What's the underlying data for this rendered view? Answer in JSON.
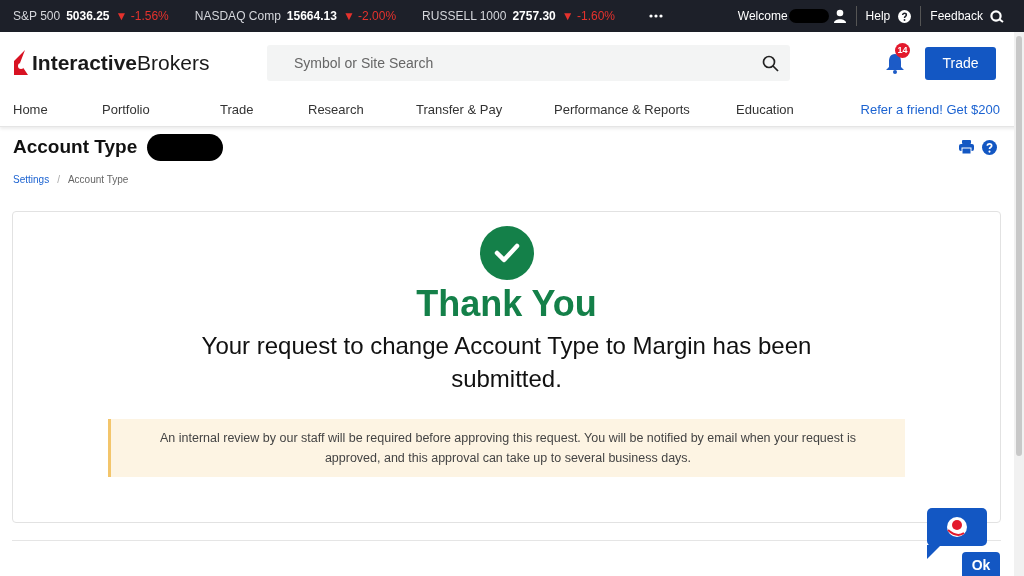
{
  "ticker": [
    {
      "name": "S&P 500",
      "value": "5036.25",
      "arrow": "▼",
      "change": "-1.56%"
    },
    {
      "name": "NASDAQ Comp",
      "value": "15664.13",
      "arrow": "▼",
      "change": "-2.00%"
    },
    {
      "name": "RUSSELL 1000",
      "value": "2757.30",
      "arrow": "▼",
      "change": "-1.60%"
    }
  ],
  "top_links": {
    "welcome": "Welcome",
    "help": "Help",
    "feedback": "Feedback"
  },
  "logo": {
    "bold": "Interactive",
    "light": "Brokers"
  },
  "search": {
    "placeholder": "Symbol or Site Search"
  },
  "notifications": {
    "count": "14"
  },
  "trade_button": "Trade",
  "nav": [
    "Home",
    "Portfolio",
    "Trade",
    "Research",
    "Transfer & Pay",
    "Performance & Reports",
    "Education"
  ],
  "refer_link": "Refer a friend! Get $200",
  "page_title": "Account Type",
  "breadcrumb": [
    {
      "label": "Settings",
      "link": true
    },
    {
      "separator": "/",
      "label": "Account Type",
      "link": false
    }
  ],
  "confirmation": {
    "heading": "Thank You",
    "message": "Your request to change Account Type to Margin has been submitted.",
    "notice": "An internal review by our staff will be required before approving this request. You will be notified by email when your request is approved, and this approval can take up to several business days."
  },
  "chat": {
    "button": "Ok"
  }
}
